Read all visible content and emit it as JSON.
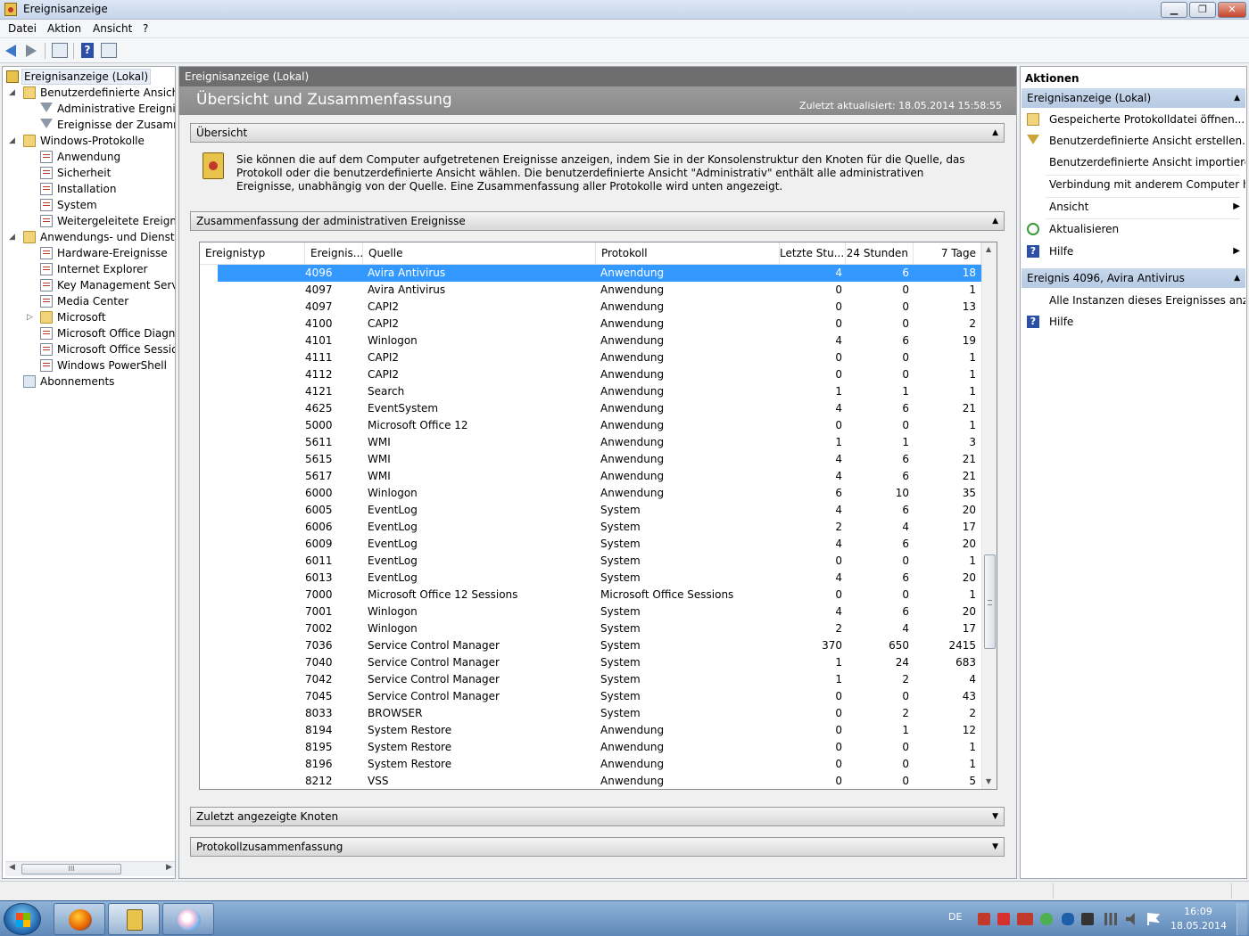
{
  "window": {
    "title": "Ereignisanzeige",
    "btn_min": "▁",
    "btn_max": "❐",
    "btn_close": "✕"
  },
  "menu": [
    "Datei",
    "Aktion",
    "Ansicht",
    "?"
  ],
  "toolbar": {
    "icons": [
      "back-arrow-icon",
      "forward-arrow-icon",
      "show-hide-tree-icon",
      "help-icon",
      "show-hide-actions-icon"
    ],
    "help_glyph": "?"
  },
  "tree": {
    "items": [
      {
        "label": "Ereignisanzeige (Lokal)",
        "icon": "event-viewer-icon"
      },
      {
        "label": "Benutzerdefinierte Ansichten",
        "icon": "folder-icon"
      },
      {
        "label": "Administrative Ereignisse",
        "icon": "filter-icon"
      },
      {
        "label": "Ereignisse der Zusammenfassung",
        "icon": "filter-icon"
      },
      {
        "label": "Windows-Protokolle",
        "icon": "folder-icon"
      },
      {
        "label": "Anwendung",
        "icon": "log-icon"
      },
      {
        "label": "Sicherheit",
        "icon": "log-icon"
      },
      {
        "label": "Installation",
        "icon": "log-icon"
      },
      {
        "label": "System",
        "icon": "log-icon"
      },
      {
        "label": "Weitergeleitete Ereignisse",
        "icon": "log-icon"
      },
      {
        "label": "Anwendungs- und Dienstprotokolle",
        "icon": "folder-icon"
      },
      {
        "label": "Hardware-Ereignisse",
        "icon": "log-icon"
      },
      {
        "label": "Internet Explorer",
        "icon": "log-icon"
      },
      {
        "label": "Key Management Service",
        "icon": "log-icon"
      },
      {
        "label": "Media Center",
        "icon": "log-icon"
      },
      {
        "label": "Microsoft",
        "icon": "folder-icon"
      },
      {
        "label": "Microsoft Office Diagnostics",
        "icon": "log-icon"
      },
      {
        "label": "Microsoft Office Sessions",
        "icon": "log-icon"
      },
      {
        "label": "Windows PowerShell",
        "icon": "log-icon"
      },
      {
        "label": "Abonnements",
        "icon": "subscriptions-icon"
      }
    ],
    "scroll_grip": "III",
    "scroll_left": "◀",
    "scroll_right": "▶"
  },
  "center": {
    "header": "Ereignisanzeige (Lokal)",
    "banner_title": "Übersicht und Zusammenfassung",
    "last_updated": "Zuletzt aktualisiert: 18.05.2014 15:58:55",
    "sections": {
      "overview": "Übersicht",
      "admin_summary": "Zusammenfassung der administrativen Ereignisse",
      "recent_nodes": "Zuletzt angezeigte Knoten",
      "log_summary": "Protokollzusammenfassung",
      "collapse_glyph": "▲",
      "expand_glyph": "▼"
    },
    "overview_text": "Sie können die auf dem Computer aufgetretenen Ereignisse anzeigen, indem Sie in der Konsolenstruktur den Knoten für die Quelle, das Protokoll oder die benutzerdefinierte Ansicht wählen. Die benutzerdefinierte Ansicht \"Administrativ\" enthält alle administrativen Ereignisse, unabhängig von der Quelle. Eine Zusammenfassung aller Protokolle wird unten angezeigt."
  },
  "table": {
    "columns": [
      "Ereignistyp",
      "Ereignis...",
      "Quelle",
      "Protokoll",
      "Letzte Stu...",
      "24 Stunden",
      "7 Tage"
    ],
    "selected_row": 0,
    "rows": [
      [
        "4096",
        "Avira Antivirus",
        "Anwendung",
        "4",
        "6",
        "18"
      ],
      [
        "4097",
        "Avira Antivirus",
        "Anwendung",
        "0",
        "0",
        "1"
      ],
      [
        "4097",
        "CAPI2",
        "Anwendung",
        "0",
        "0",
        "13"
      ],
      [
        "4100",
        "CAPI2",
        "Anwendung",
        "0",
        "0",
        "2"
      ],
      [
        "4101",
        "Winlogon",
        "Anwendung",
        "4",
        "6",
        "19"
      ],
      [
        "4111",
        "CAPI2",
        "Anwendung",
        "0",
        "0",
        "1"
      ],
      [
        "4112",
        "CAPI2",
        "Anwendung",
        "0",
        "0",
        "1"
      ],
      [
        "4121",
        "Search",
        "Anwendung",
        "1",
        "1",
        "1"
      ],
      [
        "4625",
        "EventSystem",
        "Anwendung",
        "4",
        "6",
        "21"
      ],
      [
        "5000",
        "Microsoft Office 12",
        "Anwendung",
        "0",
        "0",
        "1"
      ],
      [
        "5611",
        "WMI",
        "Anwendung",
        "1",
        "1",
        "3"
      ],
      [
        "5615",
        "WMI",
        "Anwendung",
        "4",
        "6",
        "21"
      ],
      [
        "5617",
        "WMI",
        "Anwendung",
        "4",
        "6",
        "21"
      ],
      [
        "6000",
        "Winlogon",
        "Anwendung",
        "6",
        "10",
        "35"
      ],
      [
        "6005",
        "EventLog",
        "System",
        "4",
        "6",
        "20"
      ],
      [
        "6006",
        "EventLog",
        "System",
        "2",
        "4",
        "17"
      ],
      [
        "6009",
        "EventLog",
        "System",
        "4",
        "6",
        "20"
      ],
      [
        "6011",
        "EventLog",
        "System",
        "0",
        "0",
        "1"
      ],
      [
        "6013",
        "EventLog",
        "System",
        "4",
        "6",
        "20"
      ],
      [
        "7000",
        "Microsoft Office 12 Sessions",
        "Microsoft Office Sessions",
        "0",
        "0",
        "1"
      ],
      [
        "7001",
        "Winlogon",
        "System",
        "4",
        "6",
        "20"
      ],
      [
        "7002",
        "Winlogon",
        "System",
        "2",
        "4",
        "17"
      ],
      [
        "7036",
        "Service Control Manager",
        "System",
        "370",
        "650",
        "2415"
      ],
      [
        "7040",
        "Service Control Manager",
        "System",
        "1",
        "24",
        "683"
      ],
      [
        "7042",
        "Service Control Manager",
        "System",
        "1",
        "2",
        "4"
      ],
      [
        "7045",
        "Service Control Manager",
        "System",
        "0",
        "0",
        "43"
      ],
      [
        "8033",
        "BROWSER",
        "System",
        "0",
        "2",
        "2"
      ],
      [
        "8194",
        "System Restore",
        "Anwendung",
        "0",
        "1",
        "12"
      ],
      [
        "8195",
        "System Restore",
        "Anwendung",
        "0",
        "0",
        "1"
      ],
      [
        "8196",
        "System Restore",
        "Anwendung",
        "0",
        "0",
        "1"
      ],
      [
        "8212",
        "VSS",
        "Anwendung",
        "0",
        "0",
        "5"
      ]
    ],
    "scroll_up": "▲",
    "scroll_down": "▼"
  },
  "actions": {
    "title": "Aktionen",
    "group1": "Ereignisanzeige (Lokal)",
    "group1_items": [
      {
        "label": "Gespeicherte Protokolldatei öffnen...",
        "icon": "open-folder-icon"
      },
      {
        "label": "Benutzerdefinierte Ansicht erstellen...",
        "icon": "filter-icon"
      },
      {
        "label": "Benutzerdefinierte Ansicht importieren...",
        "icon": ""
      },
      {
        "label": "Verbindung mit anderem Computer herstellen...",
        "icon": ""
      },
      {
        "label": "Ansicht",
        "icon": "",
        "submenu": "▶"
      },
      {
        "label": "Aktualisieren",
        "icon": "refresh-icon"
      },
      {
        "label": "Hilfe",
        "icon": "help-icon",
        "submenu": "▶"
      }
    ],
    "group2": "Ereignis 4096, Avira Antivirus",
    "group2_items": [
      {
        "label": "Alle Instanzen dieses Ereignisses anzeigen",
        "icon": ""
      },
      {
        "label": "Hilfe",
        "icon": "help-icon"
      }
    ],
    "collapse_glyph": "▲",
    "help_glyph": "?"
  },
  "taskbar": {
    "apps": [
      {
        "name": "firefox-icon",
        "color": "#e66000"
      },
      {
        "name": "event-viewer-icon",
        "color": "#e8c34c"
      },
      {
        "name": "paint-icon",
        "color": "#f5c4e0"
      }
    ],
    "language": "DE",
    "tray_icons": [
      "acrobat-icon",
      "acrobat-reader-icon",
      "ati-icon",
      "security-icon",
      "bluetooth-icon",
      "usb-icon",
      "network-icon",
      "volume-icon",
      "action-center-flag-icon"
    ],
    "time": "16:09",
    "date": "18.05.2014"
  }
}
